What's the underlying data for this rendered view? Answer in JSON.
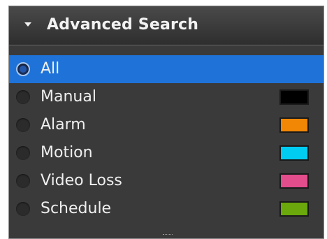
{
  "panel": {
    "title": "Advanced Search",
    "collapse_icon": "caret-down-icon"
  },
  "filters": [
    {
      "label": "All",
      "selected": true,
      "color": null
    },
    {
      "label": "Manual",
      "selected": false,
      "color": "#000000"
    },
    {
      "label": "Alarm",
      "selected": false,
      "color": "#f28705"
    },
    {
      "label": "Motion",
      "selected": false,
      "color": "#00ccf2"
    },
    {
      "label": "Video Loss",
      "selected": false,
      "color": "#e34d8c"
    },
    {
      "label": "Schedule",
      "selected": false,
      "color": "#6aa80b"
    }
  ],
  "colors": {
    "selected_row": "#1f73d8",
    "panel_bg": "#3a3a3a"
  }
}
